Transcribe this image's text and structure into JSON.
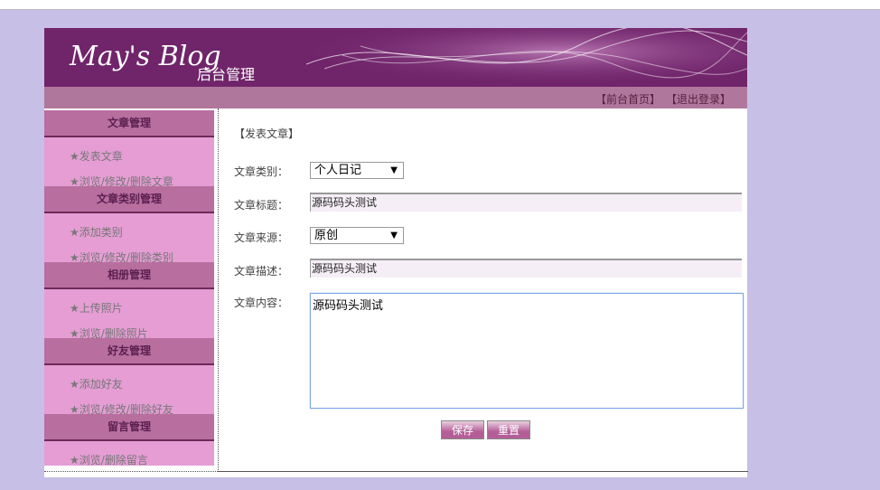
{
  "header": {
    "logo": "May's Blog",
    "subtitle": "后台管理"
  },
  "nav": {
    "home": "【前台首页】",
    "logout": "【退出登录】"
  },
  "sidebar": [
    {
      "title": "文章管理",
      "items": [
        "★发表文章",
        "★浏览/修改/删除文章"
      ]
    },
    {
      "title": "文章类别管理",
      "items": [
        "★添加类别",
        "★浏览/修改/删除类别"
      ]
    },
    {
      "title": "相册管理",
      "items": [
        "★上传照片",
        "★浏览/删除照片"
      ]
    },
    {
      "title": "好友管理",
      "items": [
        "★添加好友",
        "★浏览/修改/删除好友"
      ]
    },
    {
      "title": "留言管理",
      "items": [
        "★浏览/删除留言"
      ]
    }
  ],
  "form": {
    "title": "【发表文章】",
    "category_label": "文章类别：",
    "category_value": "个人日记",
    "title_label": "文章标题：",
    "title_value": "源码码头测试",
    "source_label": "文章来源：",
    "source_value": "原创",
    "desc_label": "文章描述：",
    "desc_value": "源码码头测试",
    "content_label": "文章内容：",
    "content_value": "源码码头测试",
    "save": "保存",
    "reset": "重置"
  }
}
